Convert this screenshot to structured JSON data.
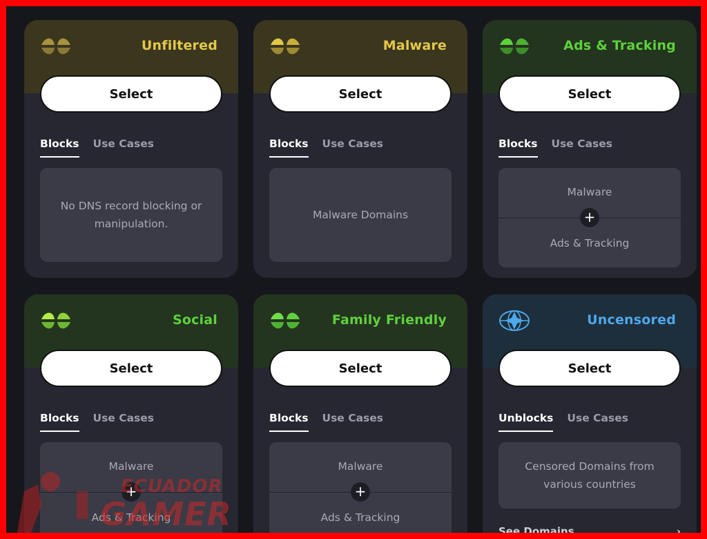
{
  "cards": [
    {
      "title": "Unfiltered",
      "title_color": "#e4c84a",
      "header_bg": "#3b361e",
      "icon": "shield-dns-icon",
      "select_label": "Select",
      "tabs": [
        "Blocks",
        "Use Cases"
      ],
      "panel_text": "No DNS record blocking or manipulation."
    },
    {
      "title": "Malware",
      "title_color": "#e4c84a",
      "header_bg": "#3b361e",
      "icon": "shield-dns-icon",
      "select_label": "Select",
      "tabs": [
        "Blocks",
        "Use Cases"
      ],
      "panel_text": "Malware Domains"
    },
    {
      "title": "Ads & Tracking",
      "title_color": "#5fd13d",
      "header_bg": "#23351f",
      "icon": "shield-dns-icon",
      "select_label": "Select",
      "tabs": [
        "Blocks",
        "Use Cases"
      ],
      "panel_top": "Malware",
      "panel_plus": "+",
      "panel_bottom": "Ads & Tracking"
    },
    {
      "title": "Social",
      "title_color": "#5fd13d",
      "header_bg": "#23351f",
      "icon": "shield-dns-icon",
      "select_label": "Select",
      "tabs": [
        "Blocks",
        "Use Cases"
      ],
      "panel_top": "Malware",
      "panel_plus": "+",
      "panel_bottom": "Ads & Tracking"
    },
    {
      "title": "Family Friendly",
      "title_color": "#5fd13d",
      "header_bg": "#23351f",
      "icon": "shield-dns-icon",
      "select_label": "Select",
      "tabs": [
        "Blocks",
        "Use Cases"
      ],
      "panel_top": "Malware",
      "panel_plus": "+",
      "panel_bottom": "Ads & Tracking"
    },
    {
      "title": "Uncensored",
      "title_color": "#4ea8ec",
      "header_bg": "#1d2f3c",
      "icon": "globe-star-icon",
      "select_label": "Select",
      "tabs": [
        "Unblocks",
        "Use Cases"
      ],
      "panel_text": "Censored Domains from various countries",
      "see_domains": "See Domains",
      "see_domains_arrow": "›"
    }
  ],
  "watermark": {
    "line1": "ECUADOR",
    "line2": "GAMER"
  }
}
